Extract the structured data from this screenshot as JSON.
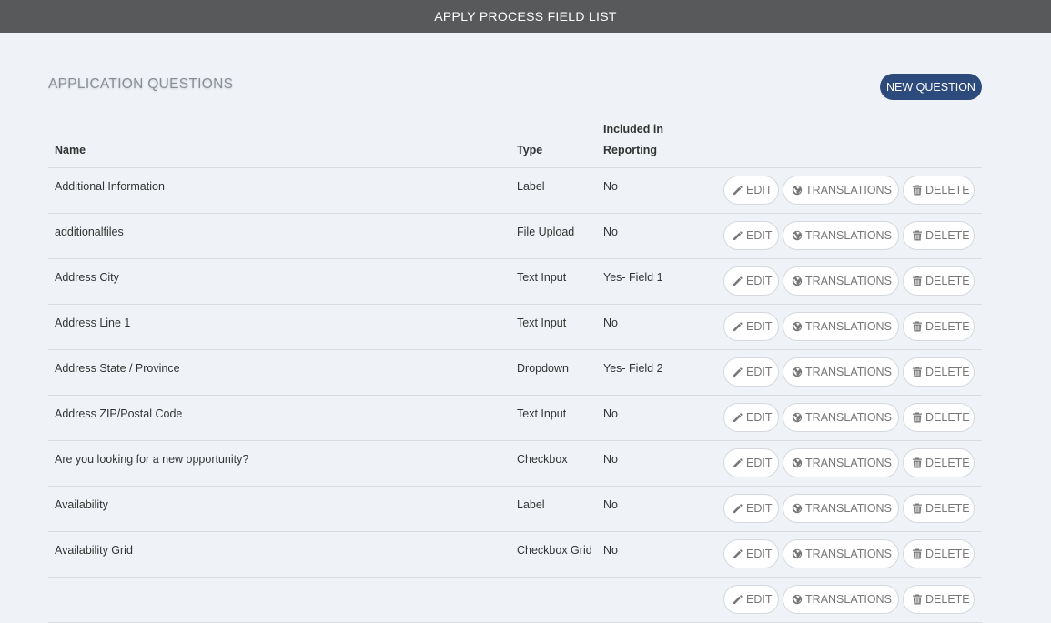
{
  "header": {
    "title": "APPLY PROCESS FIELD LIST"
  },
  "section": {
    "title": "APPLICATION QUESTIONS",
    "new_question_label": "NEW QUESTION"
  },
  "table": {
    "columns": {
      "name": "Name",
      "type": "Type",
      "reporting_line1": "Included in",
      "reporting_line2": "Reporting"
    },
    "actions": {
      "edit": "EDIT",
      "translations": "TRANSLATIONS",
      "delete": "DELETE"
    },
    "rows": [
      {
        "name": "Additional Information",
        "type": "Label",
        "reporting": "No"
      },
      {
        "name": "additionalfiles",
        "type": "File Upload",
        "reporting": "No"
      },
      {
        "name": "Address City",
        "type": "Text Input",
        "reporting": "Yes- Field 1"
      },
      {
        "name": "Address Line 1",
        "type": "Text Input",
        "reporting": "No"
      },
      {
        "name": "Address State / Province",
        "type": "Dropdown",
        "reporting": "Yes- Field 2"
      },
      {
        "name": "Address ZIP/Postal Code",
        "type": "Text Input",
        "reporting": "No"
      },
      {
        "name": "Are you looking for a new opportunity?",
        "type": "Checkbox",
        "reporting": "No"
      },
      {
        "name": "Availability",
        "type": "Label",
        "reporting": "No"
      },
      {
        "name": "Availability Grid",
        "type": "Checkbox Grid",
        "reporting": "No"
      },
      {
        "name": "",
        "type": "",
        "reporting": ""
      }
    ]
  },
  "icons": {
    "edit": "pencil-icon",
    "translations": "globe-icon",
    "delete": "trash-icon"
  },
  "colors": {
    "header_bg": "#58595b",
    "page_bg": "#eff3f7",
    "primary_button": "#2c4a7c"
  }
}
